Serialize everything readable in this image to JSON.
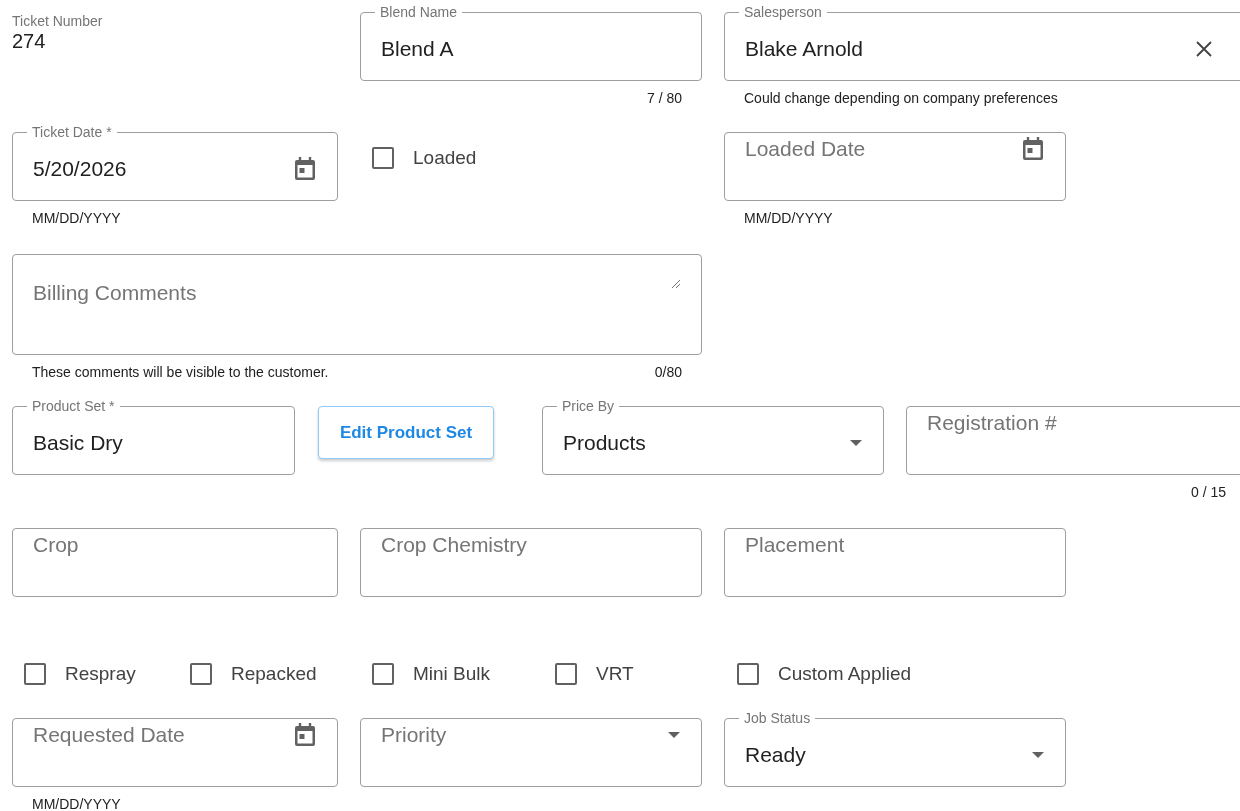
{
  "rows": [
    {
      "items": [
        {
          "kind": "display",
          "label": "Ticket Number",
          "value": "274"
        },
        {
          "kind": "field",
          "label": "Blend Name",
          "value": "Blend A",
          "counter": "7 / 80"
        },
        {
          "kind": "field",
          "label": "Salesperson",
          "value": "Blake Arnold",
          "adornment": {
            "kind": "clear"
          },
          "helper": "Could change depending on company preferences"
        }
      ]
    },
    {
      "items": [
        {
          "kind": "field",
          "label": "Ticket Date *",
          "value": "5/20/2026",
          "adornment": {
            "kind": "calendar"
          },
          "helper": "MM/DD/YYYY"
        },
        {
          "kind": "checkbox",
          "label": "Loaded",
          "checked": false
        },
        {
          "kind": "field",
          "placeholder": "Loaded Date",
          "adornment": {
            "kind": "calendar"
          },
          "helper": "MM/DD/YYYY"
        }
      ]
    },
    {
      "items": [
        {
          "kind": "textarea",
          "placeholder": "Billing Comments",
          "helper": "These comments will be visible to the customer.",
          "counter": "0/80"
        }
      ]
    },
    {
      "items": [
        {
          "kind": "field",
          "label": "Product Set *",
          "value": "Basic Dry"
        },
        {
          "kind": "button",
          "label": "Edit Product Set"
        },
        {
          "kind": "field",
          "label": "Price By",
          "value": "Products",
          "adornment": {
            "kind": "dropdown"
          }
        },
        {
          "kind": "field",
          "placeholder": "Registration #",
          "counter": "0 / 15"
        }
      ]
    },
    {
      "items": [
        {
          "kind": "field",
          "placeholder": "Crop"
        },
        {
          "kind": "field",
          "placeholder": "Crop Chemistry"
        },
        {
          "kind": "field",
          "placeholder": "Placement"
        }
      ]
    },
    {
      "items": [
        {
          "kind": "checkbox",
          "label": "Respray",
          "checked": false
        },
        {
          "kind": "checkbox",
          "label": "Repacked",
          "checked": false
        },
        {
          "kind": "checkbox",
          "label": "Mini Bulk",
          "checked": false
        },
        {
          "kind": "checkbox",
          "label": "VRT",
          "checked": false
        },
        {
          "kind": "checkbox",
          "label": "Custom Applied",
          "checked": false
        }
      ]
    },
    {
      "items": [
        {
          "kind": "field",
          "placeholder": "Requested Date",
          "adornment": {
            "kind": "calendar"
          },
          "helper": "MM/DD/YYYY"
        },
        {
          "kind": "field",
          "placeholder": "Priority",
          "adornment": {
            "kind": "dropdown"
          }
        },
        {
          "kind": "field",
          "label": "Job Status",
          "value": "Ready",
          "adornment": {
            "kind": "dropdown"
          }
        }
      ]
    }
  ]
}
